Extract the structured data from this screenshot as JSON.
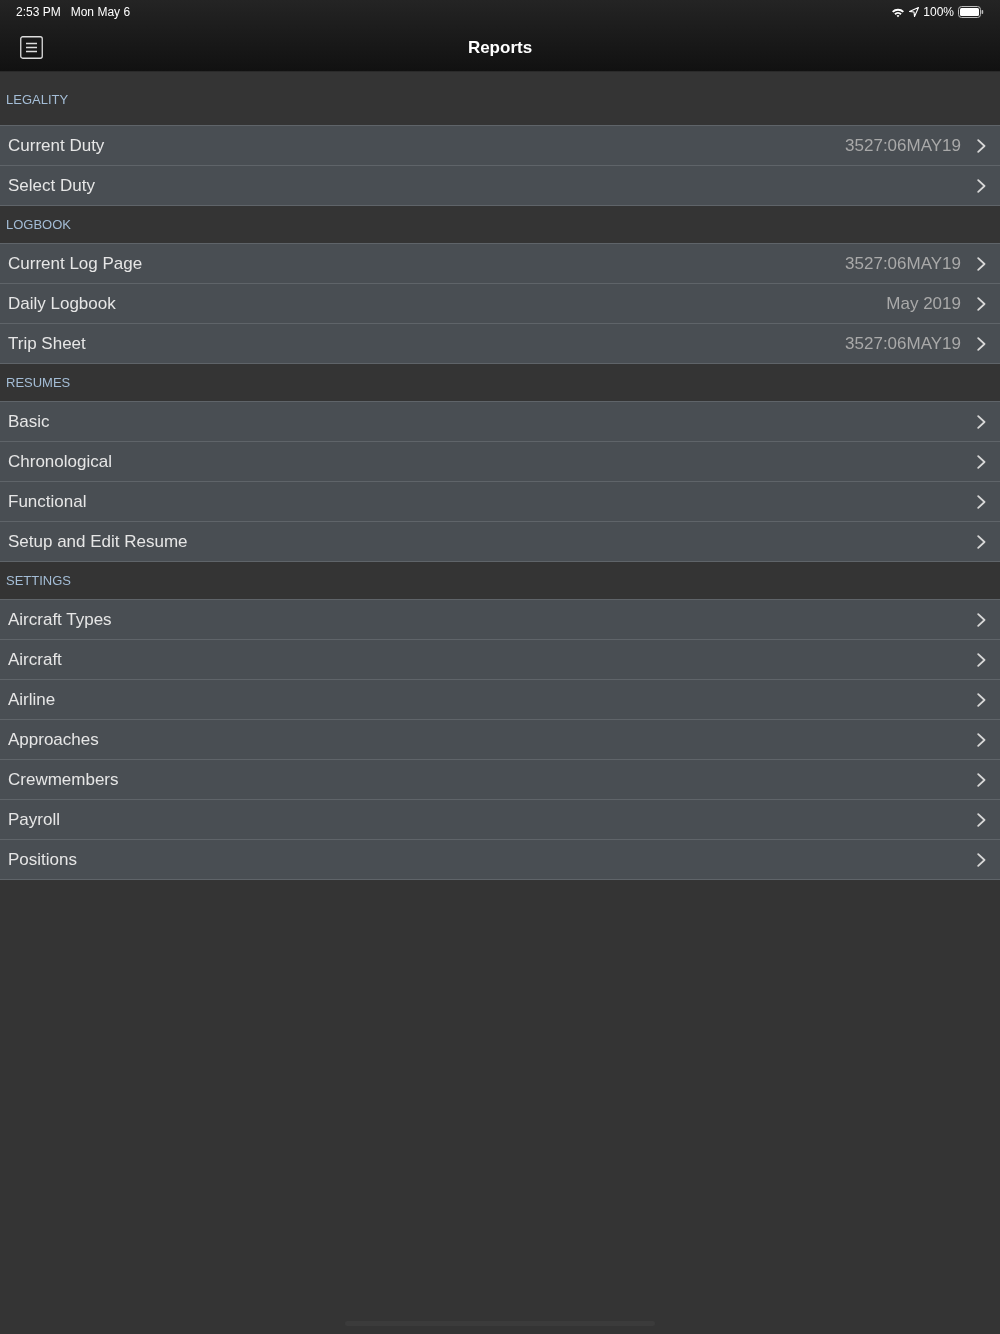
{
  "status_bar": {
    "time": "2:53 PM",
    "date": "Mon May 6",
    "battery": "100%"
  },
  "nav_bar": {
    "title": "Reports"
  },
  "sections": [
    {
      "header": "LEGALITY",
      "rows": [
        {
          "label": "Current Duty",
          "value": "3527:06MAY19"
        },
        {
          "label": "Select Duty"
        }
      ]
    },
    {
      "header": "LOGBOOK",
      "rows": [
        {
          "label": "Current Log Page",
          "value": "3527:06MAY19"
        },
        {
          "label": "Daily Logbook",
          "value": "May 2019"
        },
        {
          "label": "Trip Sheet",
          "value": "3527:06MAY19"
        }
      ]
    },
    {
      "header": "RESUMES",
      "rows": [
        {
          "label": "Basic"
        },
        {
          "label": "Chronological"
        },
        {
          "label": "Functional"
        },
        {
          "label": "Setup and Edit Resume"
        }
      ]
    },
    {
      "header": "SETTINGS",
      "rows": [
        {
          "label": "Aircraft Types"
        },
        {
          "label": "Aircraft"
        },
        {
          "label": "Airline"
        },
        {
          "label": "Approaches"
        },
        {
          "label": "Crewmembers"
        },
        {
          "label": "Payroll"
        },
        {
          "label": "Positions"
        }
      ]
    }
  ]
}
